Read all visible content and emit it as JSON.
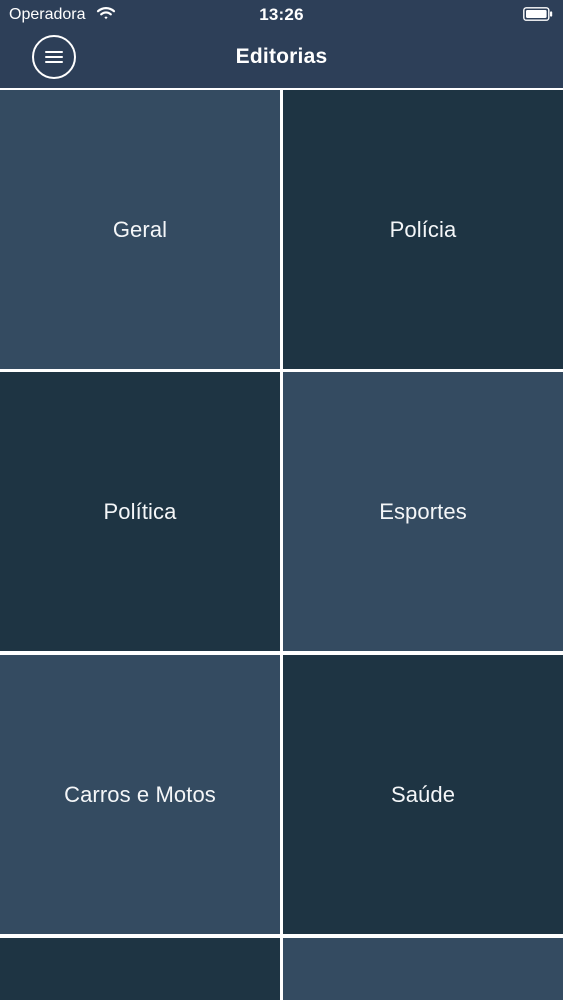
{
  "status_bar": {
    "carrier": "Operadora",
    "time": "13:26",
    "wifi_icon": "wifi-icon",
    "battery_icon": "battery-icon"
  },
  "nav": {
    "menu_icon": "hamburger-menu-icon",
    "title": "Editorias"
  },
  "sections": [
    {
      "label": "Geral",
      "tone": "light"
    },
    {
      "label": "Polícia",
      "tone": "dark"
    },
    {
      "label": "Política",
      "tone": "dark"
    },
    {
      "label": "Esportes",
      "tone": "light"
    },
    {
      "label": "Carros e Motos",
      "tone": "light"
    },
    {
      "label": "Saúde",
      "tone": "dark"
    },
    {
      "label": "",
      "tone": "dark"
    },
    {
      "label": "",
      "tone": "light"
    }
  ],
  "colors": {
    "header_background": "#2d3f58",
    "tile_light": "#344b61",
    "tile_dark": "#1e3443",
    "separator": "#ffffff",
    "text": "#ffffff"
  }
}
